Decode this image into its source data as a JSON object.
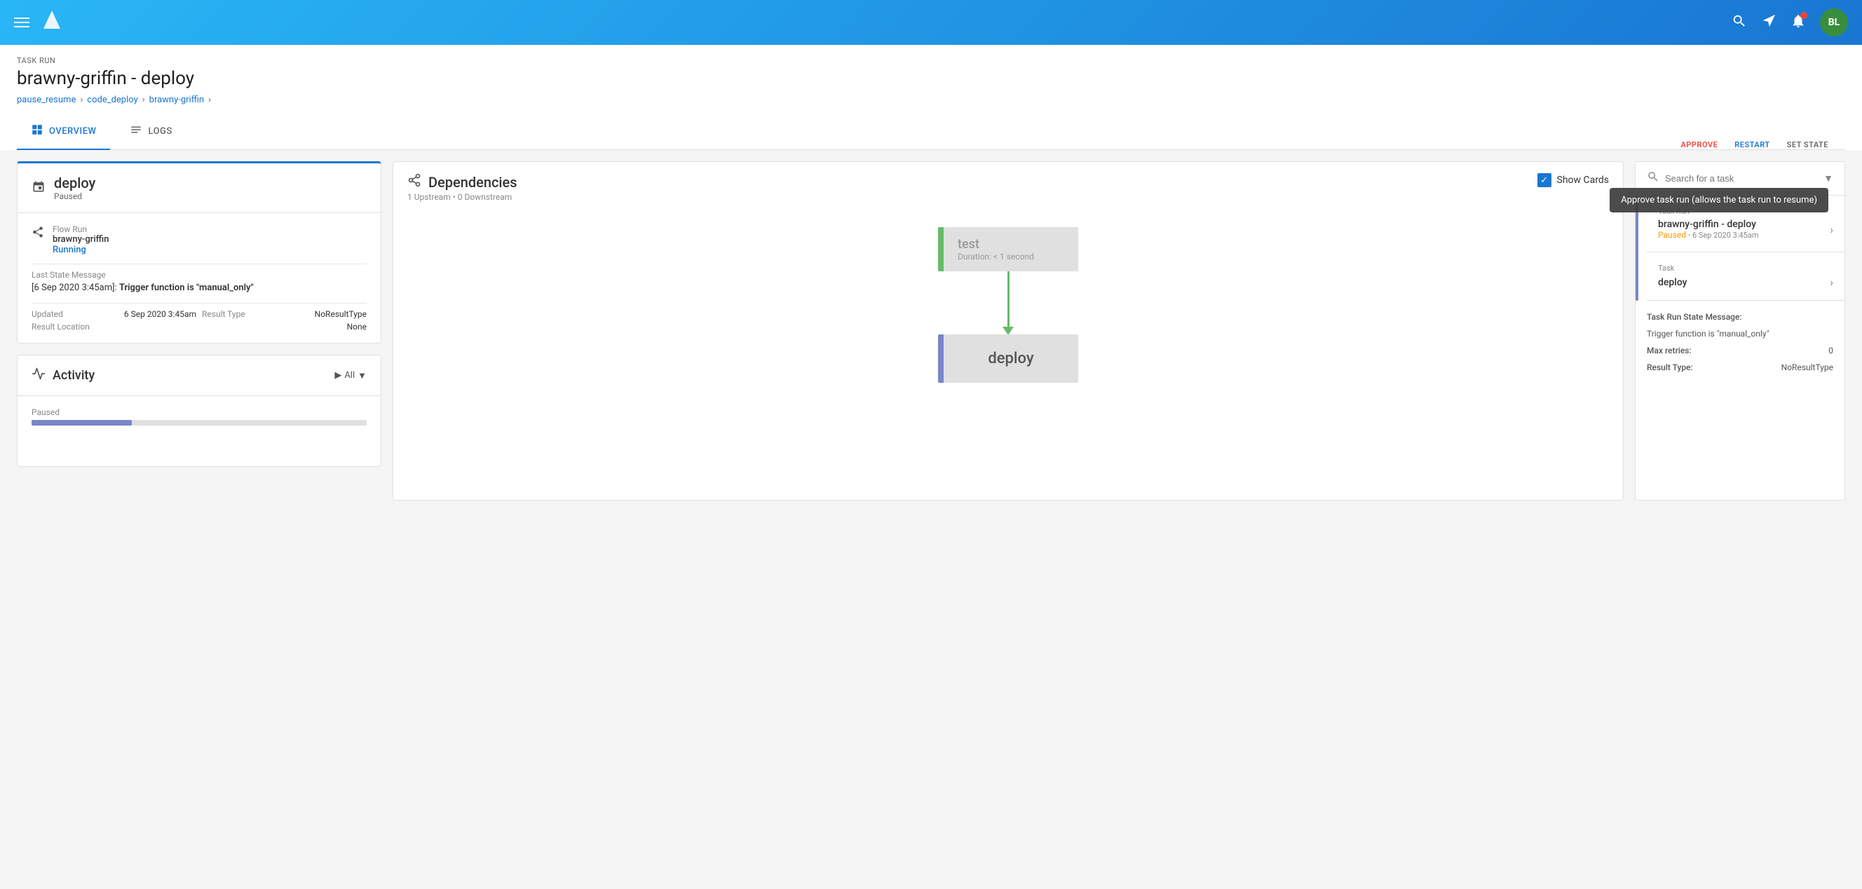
{
  "nav": {
    "avatar_initials": "BL",
    "avatar_bg": "#388e3c"
  },
  "header": {
    "task_run_label": "TASK RUN",
    "page_title": "brawny-griffin - deploy",
    "breadcrumb": [
      {
        "label": "pause_resume",
        "href": "#"
      },
      {
        "label": "code_deploy",
        "href": "#"
      },
      {
        "label": "brawny-griffin",
        "href": "#"
      }
    ],
    "approve_label": "APPROVE",
    "restart_label": "RESTART",
    "set_state_label": "SET STATE",
    "tooltip_text": "Approve task run (allows the task run to resume)"
  },
  "tabs": [
    {
      "label": "OVERVIEW",
      "id": "overview",
      "active": true
    },
    {
      "label": "LOGS",
      "id": "logs",
      "active": false
    }
  ],
  "task_card": {
    "name": "deploy",
    "status": "Paused",
    "flow_run_label": "Flow Run",
    "flow_run_name": "brawny-griffin",
    "flow_run_status": "Running",
    "last_state_label": "Last State Message",
    "last_state_timestamp": "[6 Sep 2020 3:45am]:",
    "last_state_message": "Trigger function is \"manual_only\"",
    "updated_label": "Updated",
    "updated_value": "6 Sep 2020 3:45am",
    "result_type_label": "Result Type",
    "result_type_value": "NoResultType",
    "result_location_label": "Result Location",
    "result_location_value": "None"
  },
  "activity": {
    "title": "Activity",
    "filter_label": "All",
    "paused_label": "Paused"
  },
  "dependencies": {
    "title": "Dependencies",
    "subtitle": "1 Upstream • 0 Downstream",
    "show_cards_label": "Show Cards",
    "nodes": [
      {
        "name": "test",
        "duration": "Duration: < 1 second",
        "color": "#66bb6a"
      },
      {
        "name": "deploy",
        "color": "#7986cb"
      }
    ]
  },
  "right_panel": {
    "search_placeholder": "Search for a task",
    "task_run_label": "Task Run",
    "task_run_name": "brawny-griffin - deploy",
    "task_run_status": "Paused",
    "task_run_date": "6 Sep 2020 3:45am",
    "task_label": "Task",
    "task_name": "deploy",
    "state_message_label": "Task Run State Message:",
    "state_message_value": "Trigger function is \"manual_only\"",
    "max_retries_label": "Max retries:",
    "max_retries_value": "0",
    "result_type_label": "Result Type:",
    "result_type_value": "NoResultType"
  }
}
